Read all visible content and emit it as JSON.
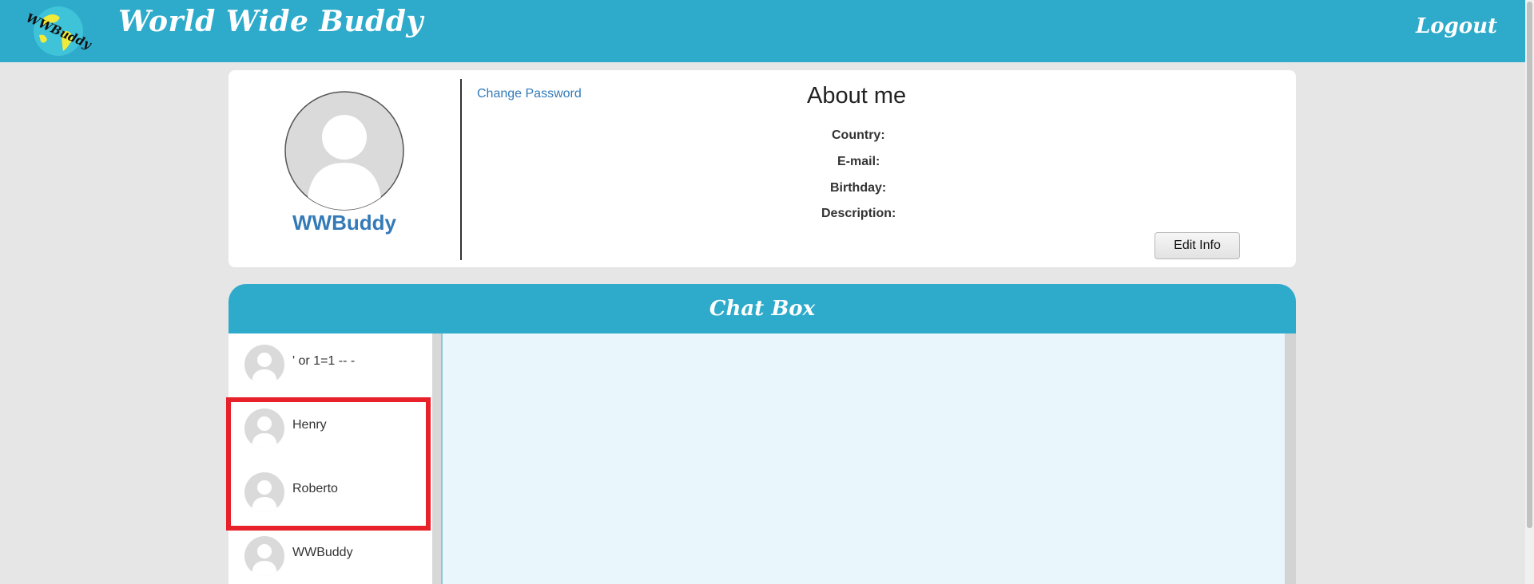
{
  "header": {
    "logo_text": "WWBuddy",
    "title": "World Wide Buddy",
    "logout_label": "Logout"
  },
  "profile": {
    "username": "WWBuddy",
    "change_password_label": "Change Password",
    "about_title": "About me",
    "fields": {
      "country_label": "Country:",
      "email_label": "E-mail:",
      "birthday_label": "Birthday:",
      "description_label": "Description:"
    },
    "edit_button_label": "Edit Info"
  },
  "chat": {
    "title": "Chat Box",
    "users": [
      {
        "name": "' or 1=1 -- -"
      },
      {
        "name": "Henry"
      },
      {
        "name": "Roberto"
      },
      {
        "name": "WWBuddy"
      }
    ]
  },
  "colors": {
    "brand": "#2eaacb",
    "link": "#337ab7",
    "chat_background": "#e9f6fc",
    "highlight": "#e8202a"
  }
}
